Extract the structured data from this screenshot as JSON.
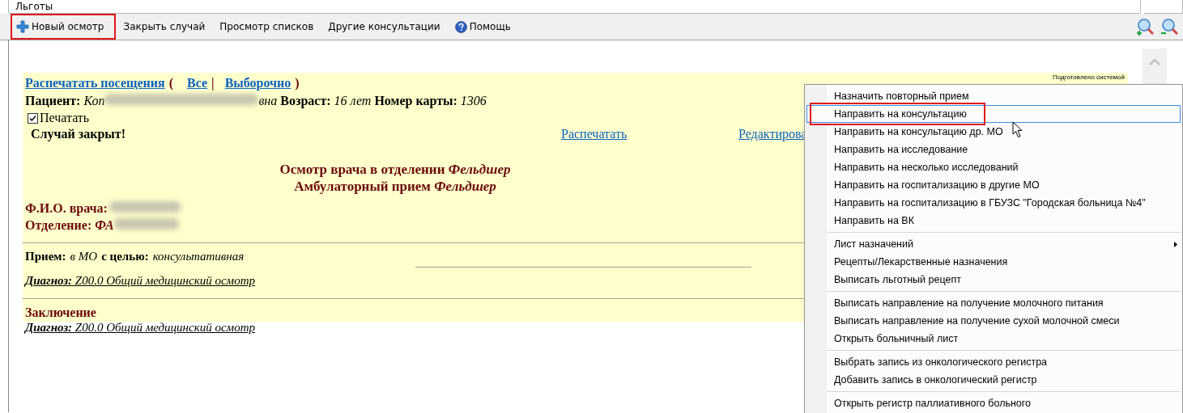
{
  "window": {
    "title": "Льготы"
  },
  "toolbar": {
    "items": [
      {
        "kind": "add",
        "label": "Новый осмотр",
        "annotated": true
      },
      {
        "kind": "plain",
        "label": "Закрыть случай",
        "annotated": false
      },
      {
        "kind": "plain",
        "label": "Просмотр списков",
        "annotated": false
      },
      {
        "kind": "plain",
        "label": "Другие консультации",
        "annotated": false
      },
      {
        "kind": "help",
        "label": "Помощь",
        "annotated": false
      }
    ],
    "zoom": [
      {
        "kind": "in"
      },
      {
        "kind": "out"
      }
    ]
  },
  "document": {
    "print_links": {
      "label": "Распечатать посещения",
      "open": "(",
      "options": [
        "Все",
        "Выборочно"
      ],
      "separator": "|",
      "close": ")"
    },
    "credit": "Подготовлено системой",
    "patient": {
      "label": "Пациент:",
      "name_start": "Коп",
      "name_end": "вна",
      "age_label": "Возраст:",
      "age": "16 лет",
      "card_label": "Номер карты:",
      "card": "1306"
    },
    "print_checkbox": {
      "label": "Печатать",
      "checked": true
    },
    "status": "Случай закрыт!",
    "actions": [
      "Распечатать",
      "Редактирова"
    ],
    "title_lines": [
      "Осмотр врача в отделении *Фельдшер*",
      "Амбулаторный прием *Фельдшер*"
    ],
    "doctor": {
      "label": "Ф.И.О. врача:"
    },
    "department": {
      "label": "Отделение:",
      "value_start": "ФА"
    },
    "reception": "**Прием:** *в МО* **с целью:** *консультативная*",
    "diagnosis": "**Диагноз:** Z00.0 Общий медицинский осмотр",
    "conclusion": {
      "heading": "Заключение",
      "diagnosis": "**Диагноз:** Z00.0 Общий медицинский осмотр"
    }
  },
  "context_menu": {
    "groups": [
      [
        {
          "kind": "action",
          "label": "Назначить повторный прием",
          "selected": false,
          "annotated": false
        },
        {
          "kind": "action",
          "label": "Направить на консультацию",
          "selected": true,
          "annotated": true
        },
        {
          "kind": "action",
          "label": "Направить на консультацию др. МО",
          "selected": false,
          "annotated": false
        },
        {
          "kind": "action",
          "label": "Направить на исследование",
          "selected": false,
          "annotated": false
        },
        {
          "kind": "action",
          "label": "Направить на несколько исследований",
          "selected": false,
          "annotated": false
        },
        {
          "kind": "action",
          "label": "Направить на госпитализацию в другие МО",
          "selected": false,
          "annotated": false
        },
        {
          "kind": "action",
          "label": "Направить на госпитализацию в ГБУЗС \"Городская больница №4\"",
          "selected": false,
          "annotated": false
        },
        {
          "kind": "action",
          "label": "Направить на ВК",
          "selected": false,
          "annotated": false
        }
      ],
      [
        {
          "kind": "submenu",
          "label": "Лист назначений",
          "selected": false,
          "annotated": false
        },
        {
          "kind": "action",
          "label": "Рецепты/Лекарственные назначения",
          "selected": false,
          "annotated": false
        },
        {
          "kind": "action",
          "label": "Выписать льготный рецепт",
          "selected": false,
          "annotated": false
        }
      ],
      [
        {
          "kind": "action",
          "label": "Выписать направление на получение молочного питания",
          "selected": false,
          "annotated": false
        },
        {
          "kind": "action",
          "label": "Выписать направление на получение сухой молочной смеси",
          "selected": false,
          "annotated": false
        },
        {
          "kind": "action",
          "label": "Открыть больничный лист",
          "selected": false,
          "annotated": false
        }
      ],
      [
        {
          "kind": "action",
          "label": "Выбрать запись из онкологического регистра",
          "selected": false,
          "annotated": false
        },
        {
          "kind": "action",
          "label": "Добавить запись в онкологический регистр",
          "selected": false,
          "annotated": false
        }
      ],
      [
        {
          "kind": "action",
          "label": "Открыть регистр паллиативного больного",
          "selected": false,
          "annotated": false
        }
      ]
    ]
  }
}
